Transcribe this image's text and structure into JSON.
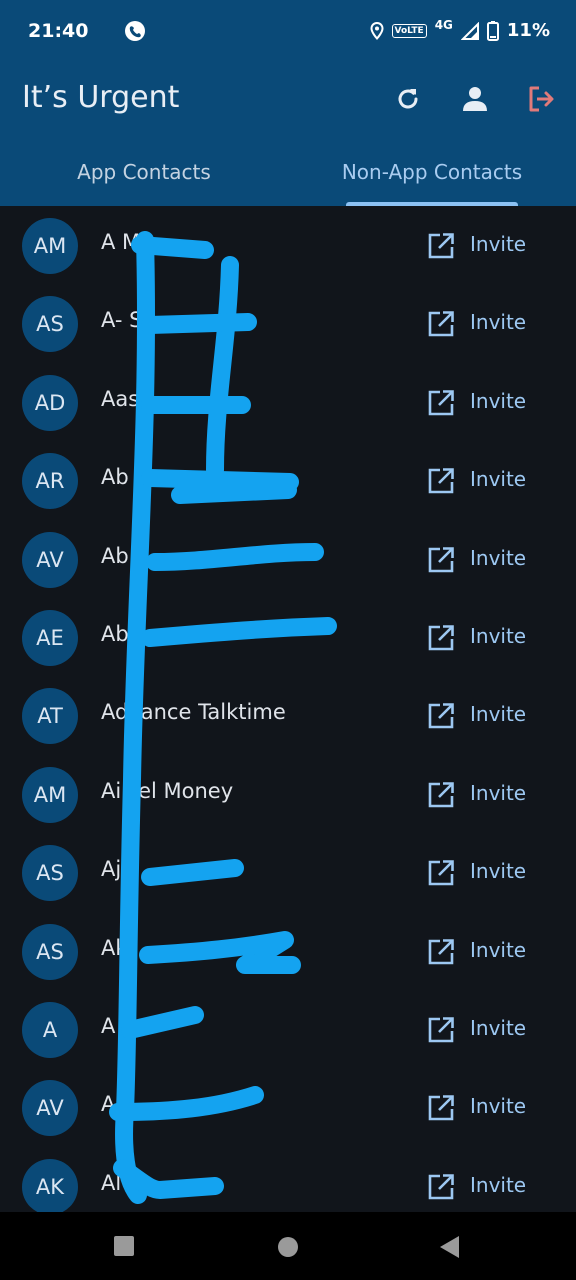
{
  "status": {
    "time": "21:40",
    "volte": "VoLTE",
    "network": "4G",
    "battery": "11%"
  },
  "app": {
    "title": "It’s Urgent",
    "actions": [
      "refresh-icon",
      "profile-icon",
      "logout-icon"
    ]
  },
  "tabs": [
    {
      "label": "App Contacts",
      "selected": false
    },
    {
      "label": "Non-App Contacts",
      "selected": true
    }
  ],
  "contacts": [
    {
      "initials": "AM",
      "name": "A M",
      "invite": "Invite"
    },
    {
      "initials": "AS",
      "name": "A- S",
      "invite": "Invite"
    },
    {
      "initials": "AD",
      "name": "Aas",
      "invite": "Invite"
    },
    {
      "initials": "AR",
      "name": "Ab",
      "invite": "Invite"
    },
    {
      "initials": "AV",
      "name": "Ab",
      "invite": "Invite"
    },
    {
      "initials": "AE",
      "name": "Ab",
      "invite": "Invite"
    },
    {
      "initials": "AT",
      "name": "Advance Talktime",
      "invite": "Invite"
    },
    {
      "initials": "AM",
      "name": "Airtel Money",
      "invite": "Invite"
    },
    {
      "initials": "AS",
      "name": "Aj",
      "invite": "Invite"
    },
    {
      "initials": "AS",
      "name": "Ak",
      "invite": "Invite"
    },
    {
      "initials": "A",
      "name": "A",
      "invite": "Invite"
    },
    {
      "initials": "AV",
      "name": "A",
      "invite": "Invite"
    },
    {
      "initials": "AK",
      "name": "Al",
      "invite": "Invite"
    }
  ],
  "colors": {
    "header": "#0a4a78",
    "background": "#11151b",
    "accent": "#9dc8f2",
    "logout": "#e07a7a",
    "redaction": "#14a3f0"
  }
}
